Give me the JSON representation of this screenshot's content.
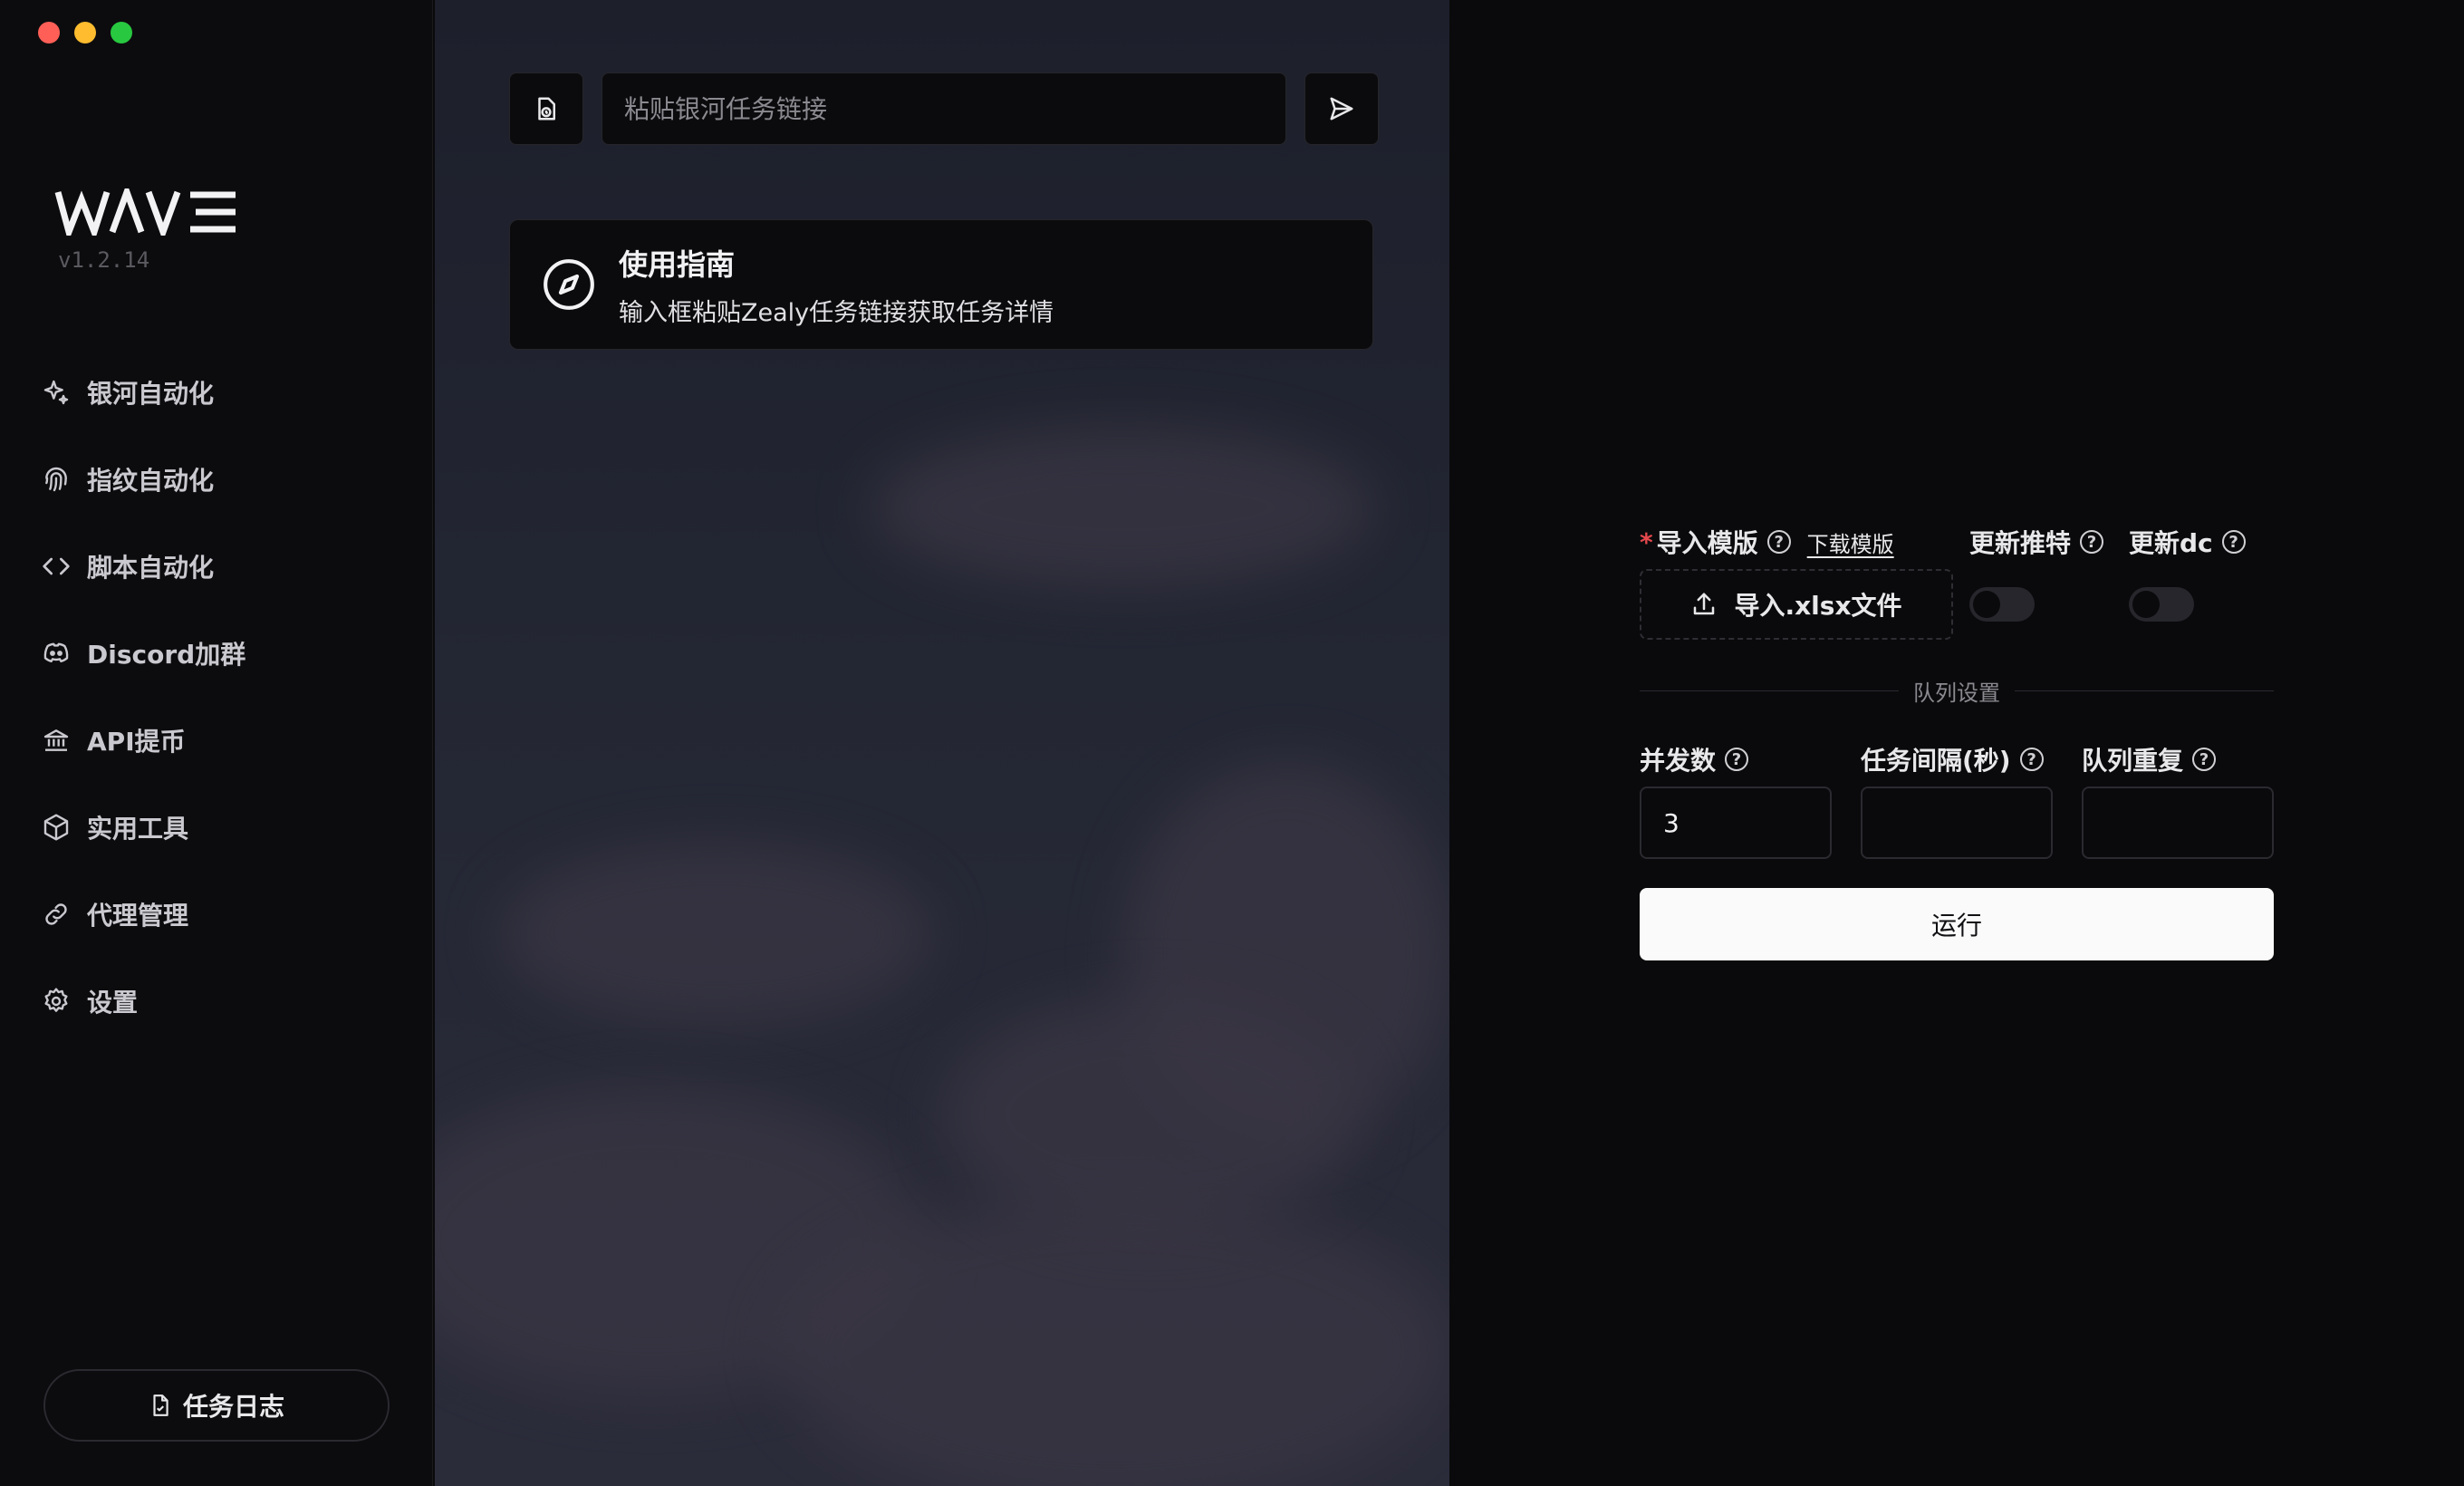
{
  "app": {
    "name": "WAVE",
    "version": "v1.2.14"
  },
  "sidebar": {
    "items": [
      {
        "label": "银河自动化",
        "icon": "sparkles-icon"
      },
      {
        "label": "指纹自动化",
        "icon": "fingerprint-icon"
      },
      {
        "label": "脚本自动化",
        "icon": "code-icon"
      },
      {
        "label": "Discord加群",
        "icon": "discord-icon"
      },
      {
        "label": "API提币",
        "icon": "bank-icon"
      },
      {
        "label": "实用工具",
        "icon": "box-icon"
      },
      {
        "label": "代理管理",
        "icon": "link-icon"
      },
      {
        "label": "设置",
        "icon": "gear-icon"
      }
    ],
    "log_button": "任务日志"
  },
  "task_link": {
    "placeholder": "粘贴银河任务链接"
  },
  "guide": {
    "title": "使用指南",
    "description": "输入框粘贴Zealy任务链接获取任务详情"
  },
  "form": {
    "import_label": "导入模版",
    "download_template": "下载模版",
    "update_twitter_label": "更新推特",
    "update_dc_label": "更新dc",
    "upload_label": "导入.xlsx文件",
    "update_twitter_on": false,
    "update_dc_on": false,
    "queue_section": "队列设置",
    "concurrency_label": "并发数",
    "concurrency_value": "3",
    "interval_label": "任务间隔(秒)",
    "interval_value": "",
    "repeat_label": "队列重复",
    "repeat_value": "",
    "run_button": "运行"
  },
  "colors": {
    "close": "#ff5f57",
    "minimize": "#febc2e",
    "maximize": "#28c840",
    "required": "#e5484d"
  }
}
